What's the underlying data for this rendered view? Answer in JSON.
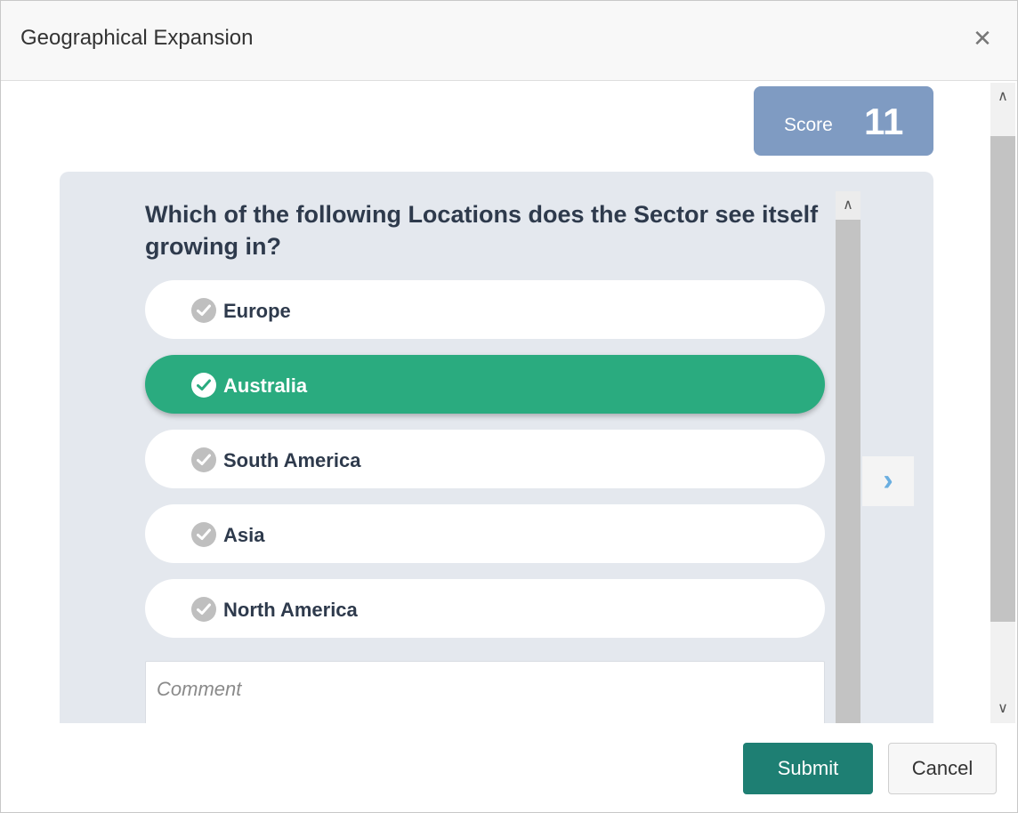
{
  "dialog": {
    "title": "Geographical Expansion",
    "close_icon": "close-icon"
  },
  "score": {
    "label": "Score",
    "value": "11",
    "color": "#7f9bc2"
  },
  "question": {
    "text": "Which of the following Locations does the Sector see itself growing in?",
    "options": [
      {
        "label": "Europe",
        "selected": false
      },
      {
        "label": "Australia",
        "selected": true
      },
      {
        "label": "South America",
        "selected": false
      },
      {
        "label": "Asia",
        "selected": false
      },
      {
        "label": "North America",
        "selected": false
      }
    ],
    "selected_color": "#2aab7f"
  },
  "comment": {
    "placeholder": "Comment",
    "value": ""
  },
  "navigation": {
    "next_icon": "chevron-right-icon"
  },
  "footer": {
    "submit_label": "Submit",
    "cancel_label": "Cancel",
    "submit_color": "#1e7f73"
  }
}
